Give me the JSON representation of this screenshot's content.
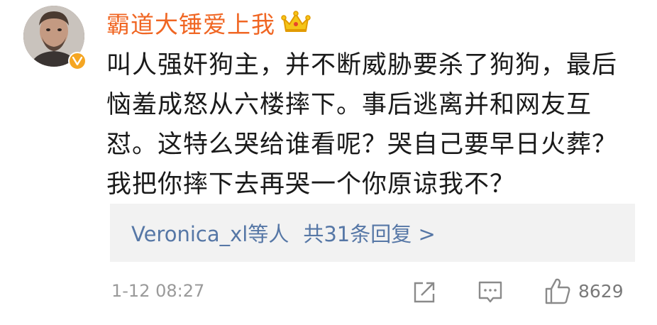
{
  "post": {
    "author": {
      "name": "霸道大锤爱上我",
      "avatar_icon": "profile-photo",
      "verified_icon": "verified-v-badge",
      "member_icon": "crown-icon",
      "accent_color": "#f06623",
      "verified_color": "#f5a623"
    },
    "text": "叫人强奸狗主，并不断威胁要杀了狗狗，最后恼羞成怒从六楼摔下。事后逃离并和网友互怼。这特么哭给谁看呢？哭自己要早日火葬？我把你摔下去再哭一个你原谅我不？",
    "replies": {
      "users": "Veronica_xl等人",
      "count_text": "共31条回复 >",
      "link_color": "#5677a6",
      "background": "#f2f2f2"
    },
    "footer": {
      "timestamp": "1-12 08:27",
      "share_icon": "share-icon",
      "comment_icon": "comment-icon",
      "like_icon": "thumbs-up-icon",
      "like_count": "8629"
    }
  }
}
